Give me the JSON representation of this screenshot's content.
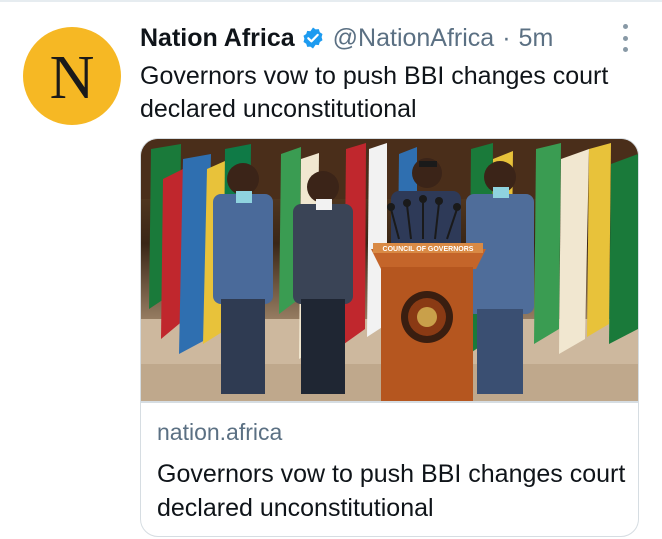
{
  "tweet": {
    "avatar_letter": "N",
    "display_name": "Nation Africa",
    "verified": true,
    "handle": "@NationAfrica",
    "separator": "·",
    "time": "5m",
    "text": "Governors vow to push BBI changes court declared unconstitutional"
  },
  "card": {
    "domain": "nation.africa",
    "title": "Governors vow to push BBI changes court declared unconstitutional",
    "image_alt": "Governors at a press conference behind a Council of Governors podium",
    "podium_label": "COUNCIL OF GOVERNORS",
    "seal_text": "COUNCIL OF GOVERNORS"
  },
  "colors": {
    "avatar_background": "#f6b824",
    "verified_badge": "#1d9bf0",
    "secondary_text": "#5b7083",
    "card_border": "#d6dde2",
    "podium": "#b5561f"
  },
  "icons": {
    "verified": "verified-badge-icon",
    "more": "more-options-icon"
  }
}
